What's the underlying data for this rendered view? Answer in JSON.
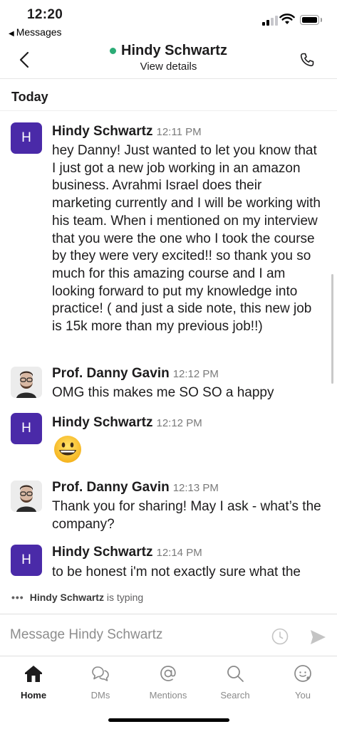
{
  "status": {
    "time": "12:20",
    "back_app": "Messages"
  },
  "header": {
    "title": "Hindy Schwartz",
    "subtitle": "View details"
  },
  "day_label": "Today",
  "messages": [
    {
      "name": "Hindy Schwartz",
      "time": "12:11 PM",
      "avatar_letter": "H",
      "text": "hey Danny! Just wanted to let you know that I just got a new job working in an amazon business. Avrahmi Israel does their marketing currently and I will be working with his team. When i mentioned on my interview that you were the one who I took the course by they were very excited!! so thank you so much for this amazing course and I am looking forward to put my knowledge into practice! ( and just a side note, this new job is 15k more than my previous job!!)"
    },
    {
      "name": "Prof. Danny Gavin",
      "time": "12:12 PM",
      "text": "OMG this makes me SO SO a happy"
    },
    {
      "name": "Hindy Schwartz",
      "time": "12:12 PM",
      "avatar_letter": "H",
      "emoji": "grinning-face"
    },
    {
      "name": "Prof. Danny Gavin",
      "time": "12:13 PM",
      "text": "Thank you for sharing! May I ask - what’s the company?"
    },
    {
      "name": "Hindy Schwartz",
      "time": "12:14 PM",
      "avatar_letter": "H",
      "text": "to be honest i'm not exactly sure what the"
    }
  ],
  "typing": {
    "dots": "•••",
    "name": "Hindy Schwartz",
    "suffix": " is typing"
  },
  "composer": {
    "placeholder": "Message Hindy Schwartz"
  },
  "tabs": [
    {
      "label": "Home",
      "icon": "home-icon",
      "active": true
    },
    {
      "label": "DMs",
      "icon": "dms-icon"
    },
    {
      "label": "Mentions",
      "icon": "mentions-icon"
    },
    {
      "label": "Search",
      "icon": "search-icon"
    },
    {
      "label": "You",
      "icon": "you-icon"
    }
  ],
  "colors": {
    "presence": "#2bac76",
    "avatar_h": "#4a2aa8",
    "text": "#1d1c1d",
    "muted": "#7a7a7a"
  }
}
